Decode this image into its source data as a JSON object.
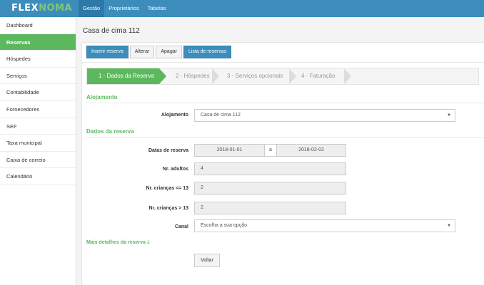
{
  "topbar": {
    "brand_part1": "FLEX",
    "brand_part2": "NOMA",
    "nav": [
      "Gestão",
      "Proprietários",
      "Tabelas"
    ]
  },
  "sidebar": {
    "items": [
      "Dashboard",
      "Reservas",
      "Hóspedes",
      "Serviços",
      "Contabilidade",
      "Fornecedores",
      "SEF",
      "Taxa municipal",
      "Caixa de correio",
      "Calendário"
    ],
    "active_index": 1
  },
  "page": {
    "title": "Casa de cima 112"
  },
  "toolbar": {
    "insert_label": "Inserir reserva",
    "edit_label": "Alterar",
    "delete_label": "Apagar",
    "list_label": "Lista de reservas"
  },
  "wizard": {
    "steps": [
      "1 - Dados da Reserva",
      "2 - Hóspedes",
      "3 - Serviços opcionais",
      "4 - Faturação"
    ],
    "active_index": 0
  },
  "alojamento": {
    "section_title": "Alojamento",
    "label": "Alojamento",
    "value": "Casa de cima 112"
  },
  "reserva": {
    "section_title": "Dados da reserva",
    "dates_label": "Datas de reserva",
    "date_from": "2018-01-01",
    "date_sep": "a",
    "date_to": "2018-02-02",
    "adults_label": "Nr. adultos",
    "adults_value": "4",
    "kids_small_label": "Nr. crianças <= 13",
    "kids_small_value": "2",
    "kids_big_label": "Nr. crianças > 13",
    "kids_big_value": "2",
    "canal_label": "Canal",
    "canal_value": "Escolha a sua opção"
  },
  "more_details": "Mais detalhes da reserva",
  "back_label": "Voltar",
  "colors": {
    "primary": "#3c8dbc",
    "success": "#5cb85c"
  }
}
